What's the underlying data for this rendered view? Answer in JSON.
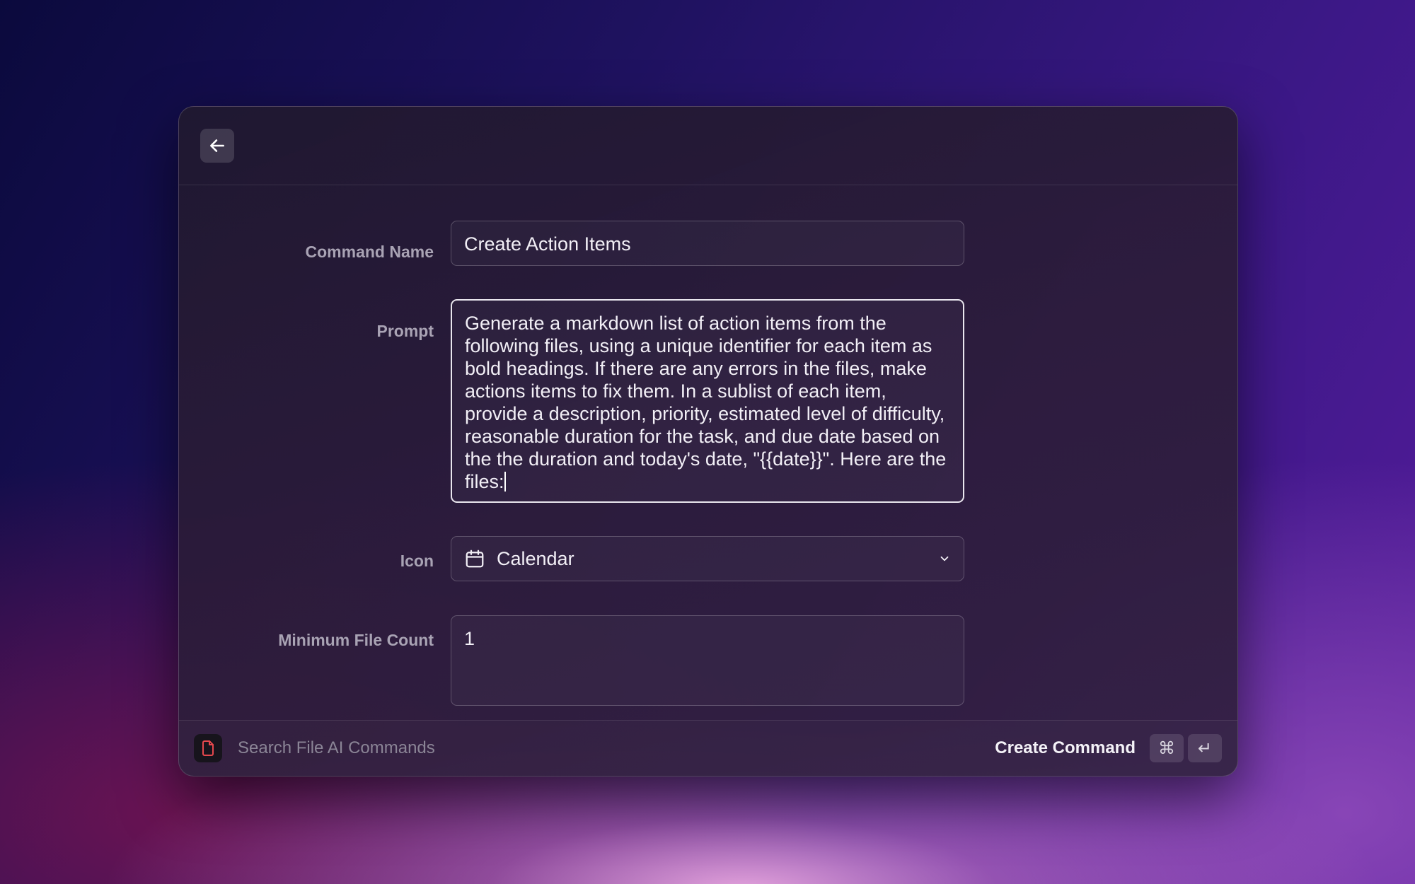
{
  "header": {
    "back_icon": "arrow-left-icon"
  },
  "form": {
    "command_name": {
      "label": "Command Name",
      "value": "Create Action Items"
    },
    "prompt": {
      "label": "Prompt",
      "value": "Generate a markdown list of action items from the following files, using a unique identifier for each item as bold headings. If there are any errors in the files, make actions items to fix them. In a sublist of each item, provide a description, priority, estimated level of difficulty, reasonable duration for the task, and due date based on the the duration and today's date, \"{{date}}\". Here are the files:"
    },
    "icon": {
      "label": "Icon",
      "value": "Calendar",
      "icon": "calendar-icon"
    },
    "min_file_count": {
      "label": "Minimum File Count",
      "value": "1"
    }
  },
  "footer": {
    "app_icon": "file-icon",
    "search_placeholder": "Search File AI Commands",
    "action_label": "Create Command",
    "shortcut_keys": [
      "⌘",
      "↵"
    ]
  },
  "colors": {
    "accent": "#e5484d",
    "text": "#f2eff6",
    "label": "#a9a3b4"
  }
}
